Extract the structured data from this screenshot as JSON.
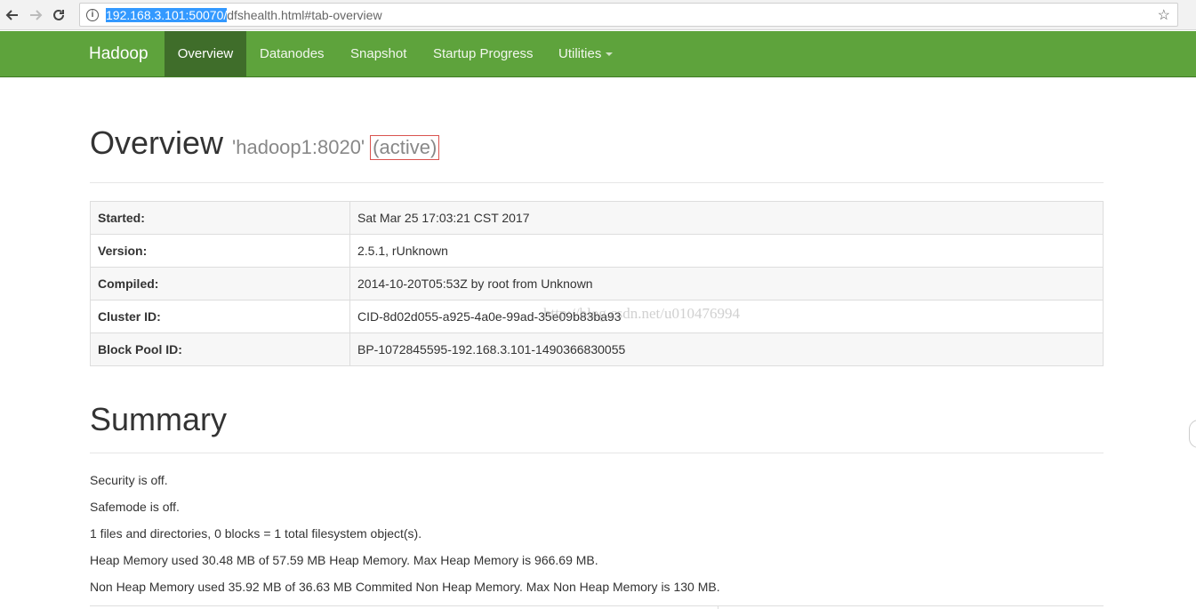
{
  "browser": {
    "url_selected": "192.168.3.101:50070/",
    "url_rest": "dfshealth.html#tab-overview"
  },
  "navbar": {
    "brand": "Hadoop",
    "items": [
      {
        "label": "Overview"
      },
      {
        "label": "Datanodes"
      },
      {
        "label": "Snapshot"
      },
      {
        "label": "Startup Progress"
      },
      {
        "label": "Utilities"
      }
    ]
  },
  "overview": {
    "title": "Overview",
    "host": "'hadoop1:8020'",
    "state": "(active)",
    "rows": [
      {
        "key": "Started:",
        "value": "Sat Mar 25 17:03:21 CST 2017"
      },
      {
        "key": "Version:",
        "value": "2.5.1, rUnknown"
      },
      {
        "key": "Compiled:",
        "value": "2014-10-20T05:53Z by root from Unknown"
      },
      {
        "key": "Cluster ID:",
        "value": "CID-8d02d055-a925-4a0e-99ad-35e09b83ba93"
      },
      {
        "key": "Block Pool ID:",
        "value": "BP-1072845595-192.168.3.101-1490366830055"
      }
    ]
  },
  "watermark": "http://blog.csdn.net/u010476994",
  "summary": {
    "title": "Summary",
    "lines": [
      "Security is off.",
      "Safemode is off.",
      "1 files and directories, 0 blocks = 1 total filesystem object(s).",
      "Heap Memory used 30.48 MB of 57.59 MB Heap Memory. Max Heap Memory is 966.69 MB.",
      "Non Heap Memory used 35.92 MB of 36.63 MB Commited Non Heap Memory. Max Non Heap Memory is 130 MB."
    ]
  }
}
